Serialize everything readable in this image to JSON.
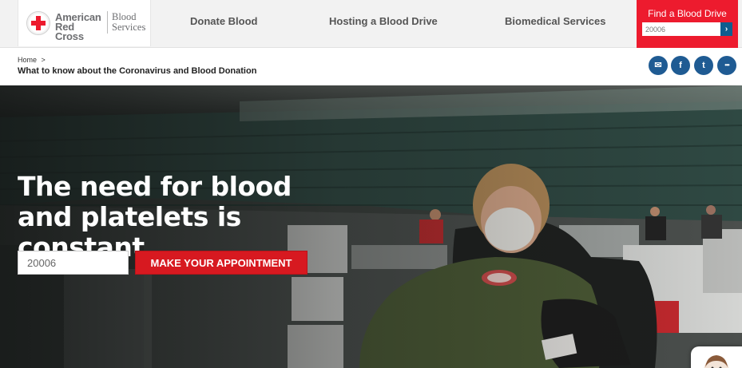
{
  "logo": {
    "name_line1": "American",
    "name_line2": "Red Cross",
    "sub_line1": "Blood",
    "sub_line2": "Services"
  },
  "nav": {
    "items": [
      {
        "label": "Donate Blood"
      },
      {
        "label": "Hosting a Blood Drive"
      },
      {
        "label": "Biomedical Services"
      }
    ]
  },
  "find_drive": {
    "title": "Find a Blood Drive",
    "zip_value": "20006",
    "go_glyph": "›"
  },
  "breadcrumb": {
    "home": "Home",
    "separator": ">",
    "current": "What to know about the Coronavirus and Blood Donation"
  },
  "share": {
    "icons": [
      "email-icon",
      "facebook-icon",
      "twitter-icon",
      "more-icon"
    ],
    "glyphs": [
      "✉",
      "f",
      "t",
      "•••"
    ]
  },
  "hero": {
    "headline": "The need for blood and platelets is constant.",
    "zip_value": "20006",
    "cta_label": "MAKE YOUR APPOINTMENT"
  },
  "colors": {
    "brand_red": "#ed1b2e",
    "cta_red": "#d71920",
    "share_blue": "#1f5b93",
    "find_btn_blue": "#0e5d8f"
  }
}
